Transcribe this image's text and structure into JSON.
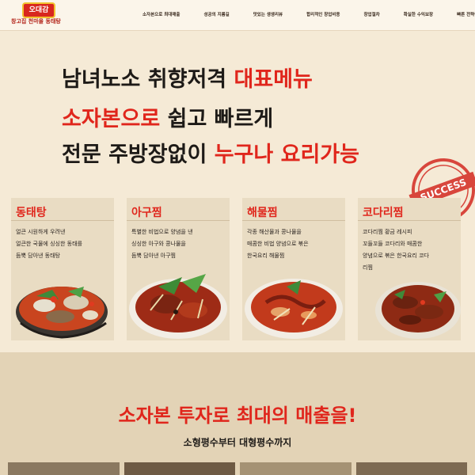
{
  "brand": {
    "badge": "오대감",
    "tagline": "창고집 천마을 동태탕"
  },
  "nav": {
    "items": [
      "소자본으로 최대매출",
      "성공의 지름길",
      "맛있는 생생리뷰",
      "합리적인 창업비용",
      "창업절차",
      "확실한 수익보장",
      "빠른 전략상담"
    ]
  },
  "hero": {
    "line1_a": "남녀노소 취향저격 ",
    "line1_b": "대표메뉴",
    "line2_a": "소자본으로",
    "line2_b": " 쉽고 빠르게",
    "line3_a": "전문 주방장없이 ",
    "line3_b": "누구나 요리가능"
  },
  "stamp": {
    "text": "SUCCESS"
  },
  "menus": [
    {
      "title": "동태탕",
      "desc": [
        "얼큰 시원하게 우려낸",
        "얼큰한 국물에 싱싱한 동태를",
        "듬뿍 담아낸 동태탕"
      ]
    },
    {
      "title": "아구찜",
      "desc": [
        "특별한 비법으로 양념을 낸",
        "싱싱한 아구와 콩나물을",
        "듬뿍 담아낸 아구찜"
      ]
    },
    {
      "title": "해물찜",
      "desc": [
        "각종 해산물과 콩나물을",
        "매콤한 비법 양념으로 볶은",
        "한국요리 해물찜"
      ]
    },
    {
      "title": "코다리찜",
      "desc": [
        "코다리찜 황금 레시피",
        "꼬들꼬들 코다리와 매콤한",
        "양념으로 볶은 한국요리 코다",
        "리찜"
      ]
    }
  ],
  "section2": {
    "title": "소자본 투자로 최대의 매출을!",
    "subtitle": "소형평수부터 대형평수까지"
  },
  "colors": {
    "accent": "#e0261c",
    "background": "#f5ead6",
    "card": "#e9dcc3"
  }
}
